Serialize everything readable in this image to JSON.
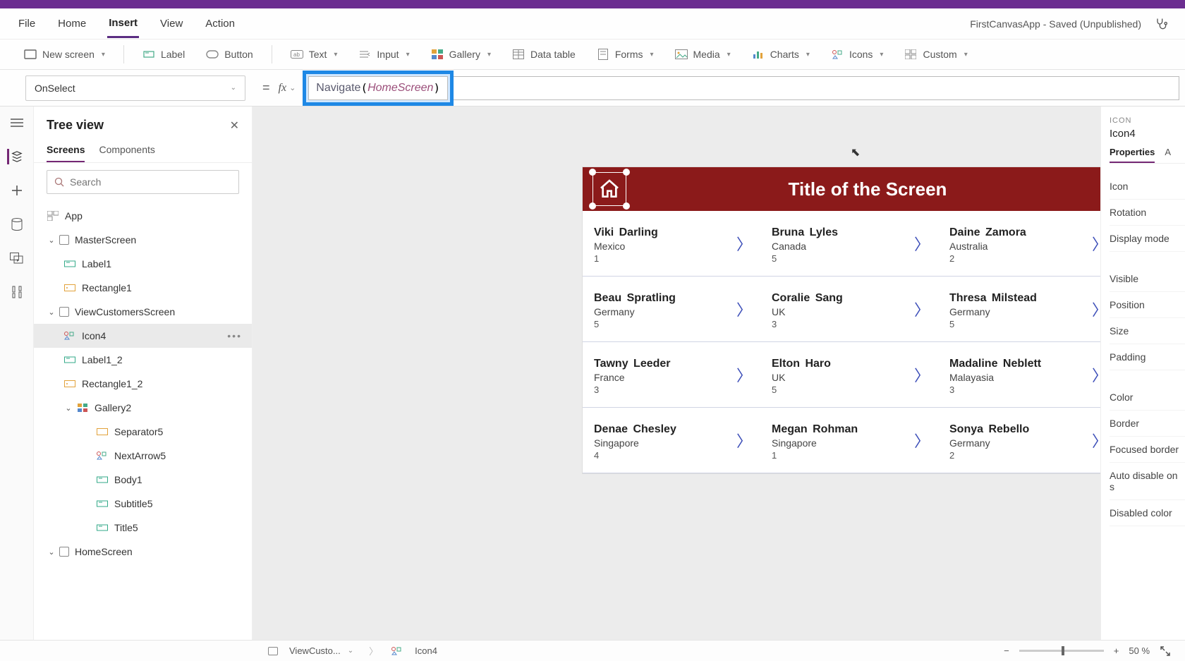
{
  "header": {
    "save_status": "FirstCanvasApp - Saved (Unpublished)"
  },
  "menu": {
    "file": "File",
    "home": "Home",
    "insert": "Insert",
    "view": "View",
    "action": "Action"
  },
  "ribbon": {
    "new_screen": "New screen",
    "label": "Label",
    "button": "Button",
    "text": "Text",
    "input": "Input",
    "gallery": "Gallery",
    "data_table": "Data table",
    "forms": "Forms",
    "media": "Media",
    "charts": "Charts",
    "icons": "Icons",
    "custom": "Custom"
  },
  "formula": {
    "property": "OnSelect",
    "fn": "Navigate",
    "arg": "HomeScreen"
  },
  "tree": {
    "title": "Tree view",
    "tabs": {
      "screens": "Screens",
      "components": "Components"
    },
    "search_placeholder": "Search",
    "app": "App",
    "items": [
      {
        "label": "MasterScreen"
      },
      {
        "label": "Label1"
      },
      {
        "label": "Rectangle1"
      },
      {
        "label": "ViewCustomersScreen"
      },
      {
        "label": "Icon4"
      },
      {
        "label": "Label1_2"
      },
      {
        "label": "Rectangle1_2"
      },
      {
        "label": "Gallery2"
      },
      {
        "label": "Separator5"
      },
      {
        "label": "NextArrow5"
      },
      {
        "label": "Body1"
      },
      {
        "label": "Subtitle5"
      },
      {
        "label": "Title5"
      },
      {
        "label": "HomeScreen"
      }
    ]
  },
  "screen": {
    "title": "Title of the Screen",
    "records": [
      {
        "name": "Viki  Darling",
        "sub": "Mexico",
        "body": "1"
      },
      {
        "name": "Bruna  Lyles",
        "sub": "Canada",
        "body": "5"
      },
      {
        "name": "Daine  Zamora",
        "sub": "Australia",
        "body": "2"
      },
      {
        "name": "Beau  Spratling",
        "sub": "Germany",
        "body": "5"
      },
      {
        "name": "Coralie  Sang",
        "sub": "UK",
        "body": "3"
      },
      {
        "name": "Thresa  Milstead",
        "sub": "Germany",
        "body": "5"
      },
      {
        "name": "Tawny  Leeder",
        "sub": "France",
        "body": "3"
      },
      {
        "name": "Elton  Haro",
        "sub": "UK",
        "body": "5"
      },
      {
        "name": "Madaline  Neblett",
        "sub": "Malayasia",
        "body": "3"
      },
      {
        "name": "Denae  Chesley",
        "sub": "Singapore",
        "body": "4"
      },
      {
        "name": "Megan  Rohman",
        "sub": "Singapore",
        "body": "1"
      },
      {
        "name": "Sonya  Rebello",
        "sub": "Germany",
        "body": "2"
      }
    ]
  },
  "props": {
    "cat": "ICON",
    "name": "Icon4",
    "tab_properties": "Properties",
    "fields": [
      "Icon",
      "Rotation",
      "Display mode",
      "Visible",
      "Position",
      "Size",
      "Padding",
      "Color",
      "Border",
      "Focused border",
      "Auto disable on s",
      "Disabled color"
    ]
  },
  "status": {
    "screen_crumb": "ViewCusto...",
    "ctrl_crumb": "Icon4",
    "zoom_pct": "50",
    "pct_sign": "%"
  }
}
